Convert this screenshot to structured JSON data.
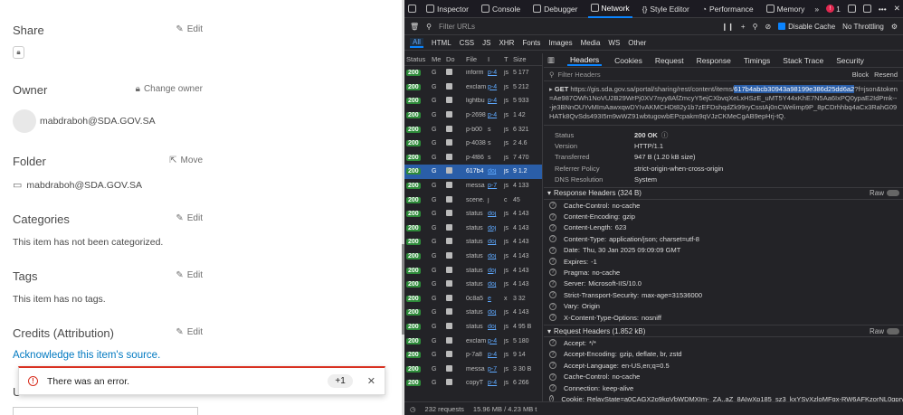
{
  "left": {
    "share": {
      "title": "Share",
      "action": "Edit"
    },
    "owner": {
      "title": "Owner",
      "action": "Change owner",
      "user": "mabdraboh@SDA.GOV.SA"
    },
    "folder": {
      "title": "Folder",
      "action": "Move",
      "value": "mabdraboh@SDA.GOV.SA"
    },
    "categories": {
      "title": "Categories",
      "action": "Edit",
      "body": "This item has not been categorized."
    },
    "tags": {
      "title": "Tags",
      "action": "Edit",
      "body": "This item has no tags."
    },
    "credits": {
      "title": "Credits (Attribution)",
      "action": "Edit",
      "link": "Acknowledge this item's source."
    },
    "toast": {
      "message": "There was an error.",
      "count": "+1"
    },
    "partial_label": "U"
  },
  "devtools": {
    "tabs": [
      "Inspector",
      "Console",
      "Debugger",
      "Network",
      "Style Editor",
      "Performance",
      "Memory"
    ],
    "error_count": "1",
    "filter_placeholder": "Filter URLs",
    "disable_cache": "Disable Cache",
    "throttling": "No Throttling",
    "types": [
      "All",
      "HTML",
      "CSS",
      "JS",
      "XHR",
      "Fonts",
      "Images",
      "Media",
      "WS",
      "Other"
    ],
    "columns": [
      "Status",
      "Me",
      "Do",
      "File",
      "I",
      "T",
      "Size"
    ],
    "rows": [
      {
        "status": "200",
        "m": "G",
        "file": "inform",
        "i": "p-4",
        "t": "js",
        "size": "5 177"
      },
      {
        "status": "200",
        "m": "G",
        "file": "exclam",
        "i": "p-4",
        "t": "js",
        "size": "5 212"
      },
      {
        "status": "200",
        "m": "G",
        "file": "lightbu",
        "i": "p-4",
        "t": "js",
        "size": "5 933"
      },
      {
        "status": "200",
        "m": "G",
        "file": "p-2698",
        "i": "p-4",
        "t": "js",
        "size": "1 42"
      },
      {
        "status": "200",
        "m": "G",
        "file": "p-b00",
        "i": "s",
        "t": "js",
        "size": "6 321"
      },
      {
        "status": "200",
        "m": "G",
        "file": "p-4038",
        "i": "s",
        "t": "js",
        "size": "2 4.6"
      },
      {
        "status": "200",
        "m": "G",
        "file": "p-4f86",
        "i": "s",
        "t": "js",
        "size": "7 470"
      },
      {
        "status": "200",
        "m": "G",
        "file": "617b4",
        "i": "doj",
        "t": "js",
        "size": "9 1.2",
        "selected": true
      },
      {
        "status": "200",
        "m": "G",
        "file": "messa",
        "i": "p-7",
        "t": "js",
        "size": "4 133"
      },
      {
        "status": "200",
        "m": "G",
        "file": "scene.",
        "i": "j",
        "t": "c",
        "size": "45"
      },
      {
        "status": "200",
        "m": "G",
        "file": "status",
        "i": "doj",
        "t": "js",
        "size": "4 143"
      },
      {
        "status": "200",
        "m": "G",
        "file": "status",
        "i": "doj",
        "t": "js",
        "size": "4 143"
      },
      {
        "status": "200",
        "m": "G",
        "file": "status",
        "i": "doj",
        "t": "js",
        "size": "4 143"
      },
      {
        "status": "200",
        "m": "G",
        "file": "status",
        "i": "doj",
        "t": "js",
        "size": "4 143"
      },
      {
        "status": "200",
        "m": "G",
        "file": "status",
        "i": "doj",
        "t": "js",
        "size": "4 143"
      },
      {
        "status": "200",
        "m": "G",
        "file": "status",
        "i": "doj",
        "t": "js",
        "size": "4 143"
      },
      {
        "status": "200",
        "m": "G",
        "file": "0c8a5",
        "i": "e",
        "t": "x",
        "size": "3 32"
      },
      {
        "status": "200",
        "m": "G",
        "file": "status",
        "i": "doj",
        "t": "js",
        "size": "4 143"
      },
      {
        "status": "200",
        "m": "G",
        "file": "status",
        "i": "doj",
        "t": "js",
        "size": "4 95 B"
      },
      {
        "status": "200",
        "m": "G",
        "file": "exclam",
        "i": "p-4",
        "t": "js",
        "size": "5 180"
      },
      {
        "status": "200",
        "m": "G",
        "file": "p-7a8",
        "i": "p-4",
        "t": "js",
        "size": "9 14"
      },
      {
        "status": "200",
        "m": "G",
        "file": "messa",
        "i": "p-7",
        "t": "js",
        "size": "3 30 B"
      },
      {
        "status": "200",
        "m": "G",
        "file": "copyT",
        "i": "p-4",
        "t": "js",
        "size": "6 266"
      }
    ],
    "status_bar": {
      "requests": "232 requests",
      "transferred": "15.96 MB / 4.23 MB t"
    },
    "detail_tabs": [
      "Headers",
      "Cookies",
      "Request",
      "Response",
      "Timings",
      "Stack Trace",
      "Security"
    ],
    "filter_headers": "Filter Headers",
    "block": "Block",
    "resend": "Resend",
    "request_method": "GET",
    "url_prefix": "https://gis.sda.gov.sa/portal/sharing/rest/content/items/",
    "url_highlight": "617b4abcb30943a98199e386d25dd6a2",
    "url_suffix": "?f=json&token=Ae987OWh1NoVU2B29WrPj0XV7nyy8AfZmcyY5ejCXbvqXeLxHSzE_uMT5Y44xKhE7N5Aa6IxPQ0ypaE2IdPmk---je3BNnOUYvMImAawxqwDYIvAKMCHDt82y1b7zEFDshqdZk99ryCsstAj0nCWelimp9P_8pCDrhhbq4aCx3RahG09HATk8QvSds493I5m9wWZ91wbtugowbEPcpakm9qVJzCKMeCgAB9epHrj-tQ.",
    "general": [
      {
        "k": "Status",
        "v": "200 OK"
      },
      {
        "k": "Version",
        "v": "HTTP/1.1"
      },
      {
        "k": "Transferred",
        "v": "947 B (1.20 kB size)"
      },
      {
        "k": "Referrer Policy",
        "v": "strict-origin-when-cross-origin"
      },
      {
        "k": "DNS Resolution",
        "v": "System"
      }
    ],
    "response_headers_title": "Response Headers (324 B)",
    "response_headers": [
      {
        "n": "Cache-Control:",
        "v": "no-cache"
      },
      {
        "n": "Content-Encoding:",
        "v": "gzip"
      },
      {
        "n": "Content-Length:",
        "v": "623"
      },
      {
        "n": "Content-Type:",
        "v": "application/json; charset=utf-8"
      },
      {
        "n": "Date:",
        "v": "Thu, 30 Jan 2025 09:09:09 GMT"
      },
      {
        "n": "Expires:",
        "v": "-1"
      },
      {
        "n": "Pragma:",
        "v": "no-cache"
      },
      {
        "n": "Server:",
        "v": "Microsoft-IIS/10.0"
      },
      {
        "n": "Strict-Transport-Security:",
        "v": "max-age=31536000"
      },
      {
        "n": "Vary:",
        "v": "Origin"
      },
      {
        "n": "X-Content-Type-Options:",
        "v": "nosniff"
      }
    ],
    "request_headers_title": "Request Headers (1.852 kB)",
    "request_headers": [
      {
        "n": "Accept:",
        "v": "*/*"
      },
      {
        "n": "Accept-Encoding:",
        "v": "gzip, deflate, br, zstd"
      },
      {
        "n": "Accept-Language:",
        "v": "en-US,en;q=0.5"
      },
      {
        "n": "Cache-Control:",
        "v": "no-cache"
      },
      {
        "n": "Connection:",
        "v": "keep-alive"
      },
      {
        "n": "Cookie:",
        "v": "RelayState=a0CAGX2o9kqVbWDMXIm-_ZA..aZ_8AIwXp185_sz3_kxYSvXzloMFqx-RW6AFKzorNL0qprysd"
      }
    ],
    "raw": "Raw"
  }
}
